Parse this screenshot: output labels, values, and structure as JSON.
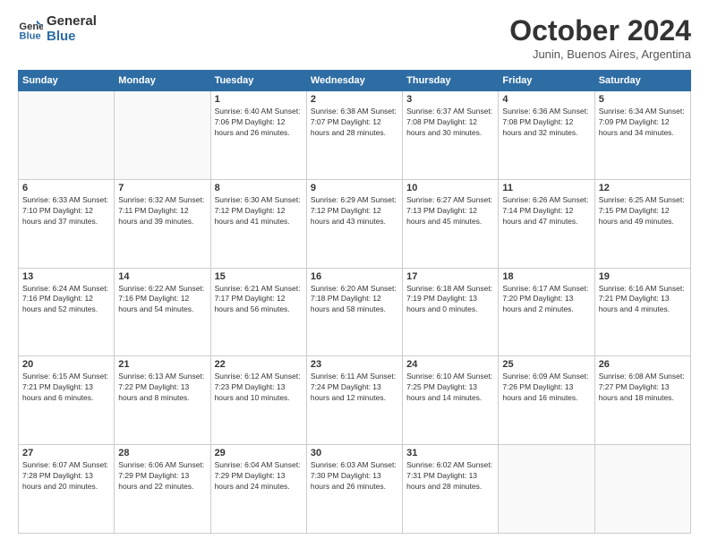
{
  "logo": {
    "line1": "General",
    "line2": "Blue"
  },
  "title": "October 2024",
  "subtitle": "Junin, Buenos Aires, Argentina",
  "days_of_week": [
    "Sunday",
    "Monday",
    "Tuesday",
    "Wednesday",
    "Thursday",
    "Friday",
    "Saturday"
  ],
  "weeks": [
    [
      {
        "day": "",
        "info": ""
      },
      {
        "day": "",
        "info": ""
      },
      {
        "day": "1",
        "info": "Sunrise: 6:40 AM\nSunset: 7:06 PM\nDaylight: 12 hours\nand 26 minutes."
      },
      {
        "day": "2",
        "info": "Sunrise: 6:38 AM\nSunset: 7:07 PM\nDaylight: 12 hours\nand 28 minutes."
      },
      {
        "day": "3",
        "info": "Sunrise: 6:37 AM\nSunset: 7:08 PM\nDaylight: 12 hours\nand 30 minutes."
      },
      {
        "day": "4",
        "info": "Sunrise: 6:36 AM\nSunset: 7:08 PM\nDaylight: 12 hours\nand 32 minutes."
      },
      {
        "day": "5",
        "info": "Sunrise: 6:34 AM\nSunset: 7:09 PM\nDaylight: 12 hours\nand 34 minutes."
      }
    ],
    [
      {
        "day": "6",
        "info": "Sunrise: 6:33 AM\nSunset: 7:10 PM\nDaylight: 12 hours\nand 37 minutes."
      },
      {
        "day": "7",
        "info": "Sunrise: 6:32 AM\nSunset: 7:11 PM\nDaylight: 12 hours\nand 39 minutes."
      },
      {
        "day": "8",
        "info": "Sunrise: 6:30 AM\nSunset: 7:12 PM\nDaylight: 12 hours\nand 41 minutes."
      },
      {
        "day": "9",
        "info": "Sunrise: 6:29 AM\nSunset: 7:12 PM\nDaylight: 12 hours\nand 43 minutes."
      },
      {
        "day": "10",
        "info": "Sunrise: 6:27 AM\nSunset: 7:13 PM\nDaylight: 12 hours\nand 45 minutes."
      },
      {
        "day": "11",
        "info": "Sunrise: 6:26 AM\nSunset: 7:14 PM\nDaylight: 12 hours\nand 47 minutes."
      },
      {
        "day": "12",
        "info": "Sunrise: 6:25 AM\nSunset: 7:15 PM\nDaylight: 12 hours\nand 49 minutes."
      }
    ],
    [
      {
        "day": "13",
        "info": "Sunrise: 6:24 AM\nSunset: 7:16 PM\nDaylight: 12 hours\nand 52 minutes."
      },
      {
        "day": "14",
        "info": "Sunrise: 6:22 AM\nSunset: 7:16 PM\nDaylight: 12 hours\nand 54 minutes."
      },
      {
        "day": "15",
        "info": "Sunrise: 6:21 AM\nSunset: 7:17 PM\nDaylight: 12 hours\nand 56 minutes."
      },
      {
        "day": "16",
        "info": "Sunrise: 6:20 AM\nSunset: 7:18 PM\nDaylight: 12 hours\nand 58 minutes."
      },
      {
        "day": "17",
        "info": "Sunrise: 6:18 AM\nSunset: 7:19 PM\nDaylight: 13 hours\nand 0 minutes."
      },
      {
        "day": "18",
        "info": "Sunrise: 6:17 AM\nSunset: 7:20 PM\nDaylight: 13 hours\nand 2 minutes."
      },
      {
        "day": "19",
        "info": "Sunrise: 6:16 AM\nSunset: 7:21 PM\nDaylight: 13 hours\nand 4 minutes."
      }
    ],
    [
      {
        "day": "20",
        "info": "Sunrise: 6:15 AM\nSunset: 7:21 PM\nDaylight: 13 hours\nand 6 minutes."
      },
      {
        "day": "21",
        "info": "Sunrise: 6:13 AM\nSunset: 7:22 PM\nDaylight: 13 hours\nand 8 minutes."
      },
      {
        "day": "22",
        "info": "Sunrise: 6:12 AM\nSunset: 7:23 PM\nDaylight: 13 hours\nand 10 minutes."
      },
      {
        "day": "23",
        "info": "Sunrise: 6:11 AM\nSunset: 7:24 PM\nDaylight: 13 hours\nand 12 minutes."
      },
      {
        "day": "24",
        "info": "Sunrise: 6:10 AM\nSunset: 7:25 PM\nDaylight: 13 hours\nand 14 minutes."
      },
      {
        "day": "25",
        "info": "Sunrise: 6:09 AM\nSunset: 7:26 PM\nDaylight: 13 hours\nand 16 minutes."
      },
      {
        "day": "26",
        "info": "Sunrise: 6:08 AM\nSunset: 7:27 PM\nDaylight: 13 hours\nand 18 minutes."
      }
    ],
    [
      {
        "day": "27",
        "info": "Sunrise: 6:07 AM\nSunset: 7:28 PM\nDaylight: 13 hours\nand 20 minutes."
      },
      {
        "day": "28",
        "info": "Sunrise: 6:06 AM\nSunset: 7:29 PM\nDaylight: 13 hours\nand 22 minutes."
      },
      {
        "day": "29",
        "info": "Sunrise: 6:04 AM\nSunset: 7:29 PM\nDaylight: 13 hours\nand 24 minutes."
      },
      {
        "day": "30",
        "info": "Sunrise: 6:03 AM\nSunset: 7:30 PM\nDaylight: 13 hours\nand 26 minutes."
      },
      {
        "day": "31",
        "info": "Sunrise: 6:02 AM\nSunset: 7:31 PM\nDaylight: 13 hours\nand 28 minutes."
      },
      {
        "day": "",
        "info": ""
      },
      {
        "day": "",
        "info": ""
      }
    ]
  ]
}
